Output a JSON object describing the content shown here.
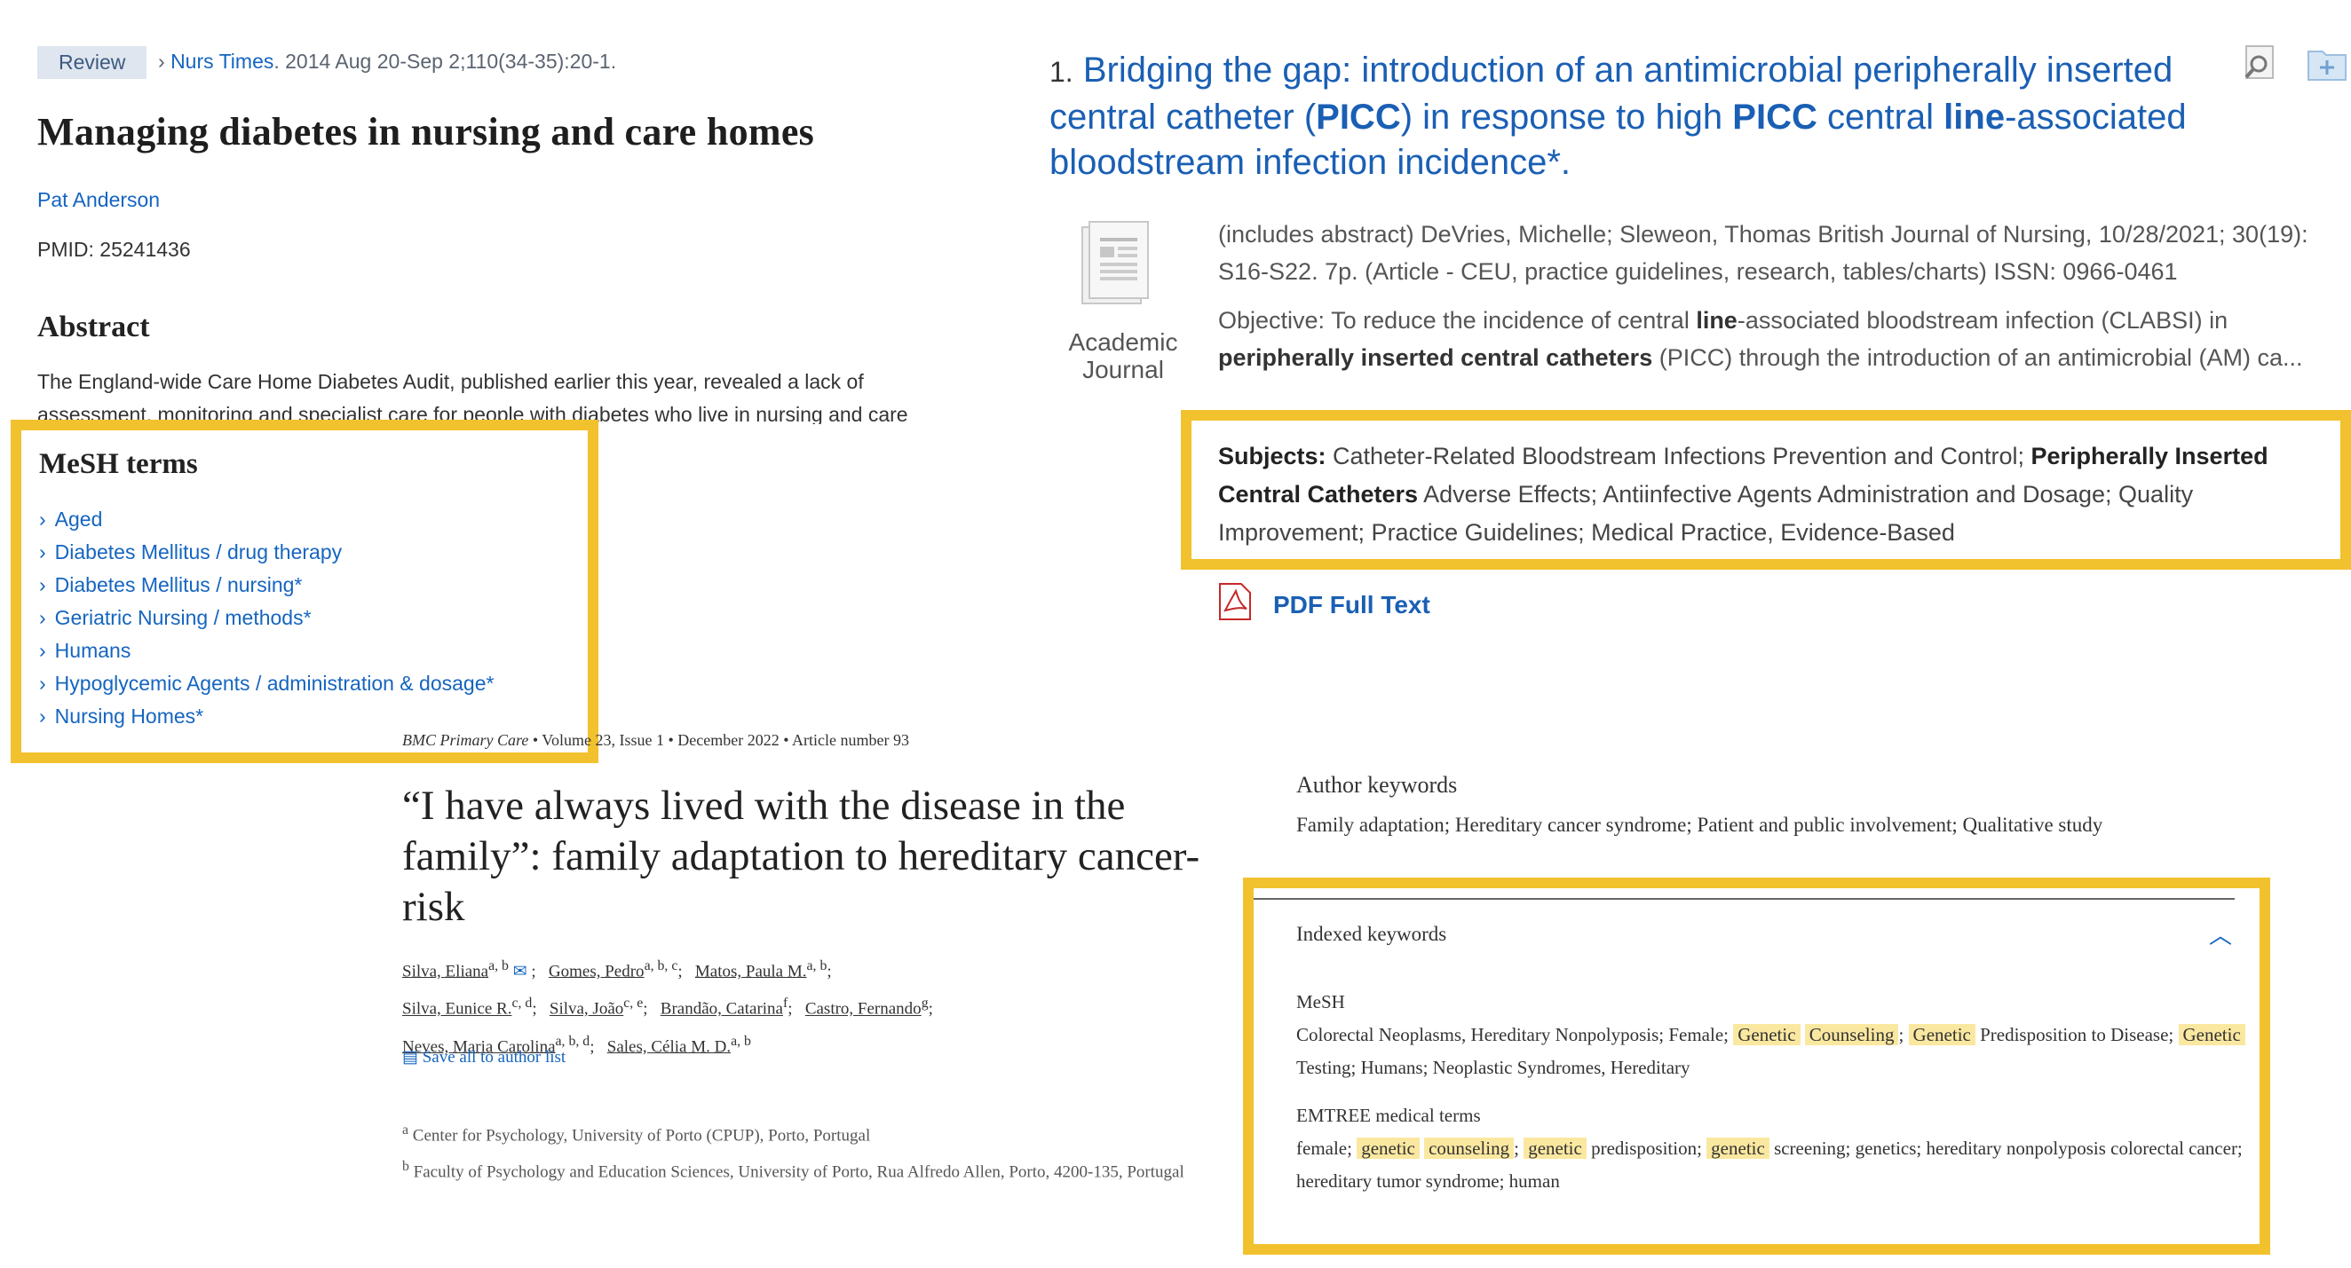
{
  "pubmed": {
    "badge": "Review",
    "journal": "Nurs Times",
    "date_vol": ". 2014 Aug 20-Sep 2;110(34-35):20-1.",
    "title": "Managing diabetes in nursing and care homes",
    "author": "Pat Anderson",
    "pmid": "PMID: 25241436",
    "abstract_heading": "Abstract",
    "abstract_text": "The England-wide Care Home Diabetes Audit, published earlier this year, revealed a lack of assessment, monitoring and specialist care for people with diabetes who live in nursing and care",
    "mesh_heading": "MeSH terms",
    "mesh_terms": [
      "Aged",
      "Diabetes Mellitus / drug therapy",
      "Diabetes Mellitus / nursing*",
      "Geriatric Nursing / methods*",
      "Humans",
      "Hypoglycemic Agents / administration & dosage*",
      "Nursing Homes*"
    ]
  },
  "ebsco": {
    "result_number": "1.",
    "title_1": "Bridging the gap: introduction of an antimicrobial peripherally inserted central catheter (",
    "title_bold_1": "PICC",
    "title_2": ") in response to high ",
    "title_bold_2": "PICC",
    "title_3": " central ",
    "title_bold_3": "line",
    "title_4": "-associated bloodstream infection incidence*.",
    "type_label": "Academic Journal",
    "meta": "(includes abstract) DeVries, Michelle; Sleweon, Thomas British Journal of Nursing, 10/28/2021; 30(19): S16-S22. 7p. (Article - CEU, practice guidelines, research, tables/charts) ISSN: 0966-0461",
    "abstract_1": "Objective: To reduce the incidence of central ",
    "abstract_bold_1": "line",
    "abstract_2": "-associated bloodstream infection (CLABSI) in ",
    "abstract_bold_2": "peripherally inserted central catheters",
    "abstract_3": " (PICC) through the introduction of an antimicrobial (AM) ca...",
    "subjects_label": "Subjects:",
    "subjects_1": " Catheter-Related Bloodstream Infections Prevention and Control; ",
    "subjects_bold": "Peripherally Inserted Central Catheters",
    "subjects_2": " Adverse Effects; Antiinfective Agents Administration and Dosage; Quality Improvement; Practice Guidelines; Medical Practice, Evidence-Based",
    "pdf_link": "PDF Full Text"
  },
  "bmc": {
    "journal": "BMC Primary Care",
    "meta_rest": " • Volume 23, Issue 1 • December 2022 • Article number 93",
    "title": "“I have always lived with the disease in the family”: family adaptation to hereditary cancer-risk",
    "authors": [
      {
        "name": "Silva, Eliana",
        "sup": "a, b"
      },
      {
        "name": "Gomes, Pedro",
        "sup": "a, b, c"
      },
      {
        "name": "Matos, Paula M.",
        "sup": "a, b"
      },
      {
        "name": "Silva, Eunice R.",
        "sup": "c, d"
      },
      {
        "name": "Silva, João",
        "sup": "c, e"
      },
      {
        "name": "Brandão, Catarina",
        "sup": "f"
      },
      {
        "name": "Castro, Fernando",
        "sup": "g"
      },
      {
        "name": "Neves, Maria Carolina",
        "sup": "a, b, d"
      },
      {
        "name": "Sales, Célia M. D.",
        "sup": "a, b"
      }
    ],
    "save_link": "Save all to author list",
    "aff_a_sup": "a",
    "aff_a": " Center for Psychology, University of Porto (CPUP), Porto, Portugal",
    "aff_b_sup": "b",
    "aff_b": " Faculty of Psychology and Education Sciences, University of Porto, Rua Alfredo Allen, Porto, 4200-135, Portugal"
  },
  "scopus": {
    "author_keywords_heading": "Author keywords",
    "author_keywords": "Family adaptation;   Hereditary cancer syndrome;   Patient and public involvement;   Qualitative study",
    "indexed_heading": "Indexed keywords",
    "mesh_heading": "MeSH",
    "mesh_1": "Colorectal Neoplasms, Hereditary Nonpolyposis;   Female;  ",
    "mesh_hl_1": "Genetic",
    "mesh_hl_2": "Counseling",
    "mesh_2": ";  ",
    "mesh_hl_3": "Genetic",
    "mesh_3": " Predisposition to Disease;  ",
    "mesh_hl_4": "Genetic",
    "mesh_4": " Testing;   Humans;   Neoplastic Syndromes, Hereditary",
    "emtree_heading": "EMTREE medical terms",
    "emt_1": "female;  ",
    "emt_hl_1": "genetic",
    "emt_hl_2": "counseling",
    "emt_2": ";  ",
    "emt_hl_3": "genetic",
    "emt_3": " predisposition;  ",
    "emt_hl_4": "genetic",
    "emt_4": " screening;   genetics;   hereditary nonpolyposis colorectal cancer;   hereditary tumor syndrome;   human"
  },
  "colors": {
    "highlight_box": "#f2c12e",
    "keyword_highlight": "#fbe8a0",
    "link_blue": "#1565c0",
    "ebsco_title_blue": "#1a5fb4"
  }
}
